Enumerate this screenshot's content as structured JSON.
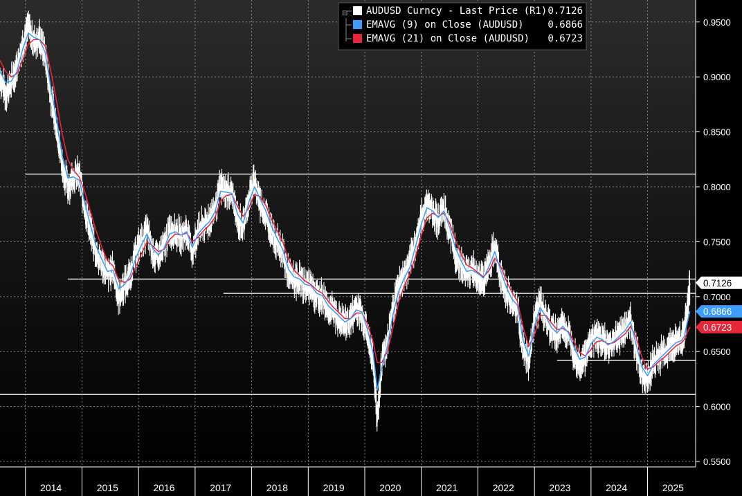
{
  "chart_data": {
    "type": "line",
    "title": "",
    "xlabel": "",
    "ylabel": "",
    "x_ticks": [
      "2014",
      "2015",
      "2016",
      "2017",
      "2018",
      "2019",
      "2020",
      "2021",
      "2022",
      "2023",
      "2024",
      "2025"
    ],
    "ylim": [
      0.545,
      0.97
    ],
    "y_ticks": [
      "0.9500",
      "0.9000",
      "0.8500",
      "0.8000",
      "0.7500",
      "0.7000",
      "0.6500",
      "0.6000",
      "0.5500"
    ],
    "grid": true,
    "legend_position": "top-center",
    "background": "#000000",
    "colors": {
      "price": "#ffffff",
      "ema9": "#3d9dff",
      "ema21": "#e8263a",
      "levels": "#ffffff"
    },
    "legend": [
      {
        "label": "AUDUSD Curncy  - Last Price (R1)",
        "value": "0.7126",
        "color": "#ffffff"
      },
      {
        "label": "EMAVG (9)  on Close (AUDUSD)",
        "value": "0.6866",
        "color": "#3d9dff"
      },
      {
        "label": "EMAVG (21)  on Close (AUDUSD)",
        "value": "0.6723",
        "color": "#e8263a"
      }
    ],
    "last_value_tags": [
      {
        "value": "0.7126",
        "y": 0.7126,
        "bg": "#ffffff",
        "fg": "#000000"
      },
      {
        "value": "0.6866",
        "y": 0.6866,
        "bg": "#3d9dff",
        "fg": "#ffffff"
      },
      {
        "value": "0.6723",
        "y": 0.6723,
        "bg": "#e8263a",
        "fg": "#ffffff"
      }
    ],
    "horizontal_levels": [
      {
        "y": 0.8115,
        "from": 2014.0
      },
      {
        "y": 0.716,
        "from": 2014.75
      },
      {
        "y": 0.703,
        "from": 2017.5
      },
      {
        "y": 0.642,
        "from": 2023.4
      },
      {
        "y": 0.611,
        "from": 2013.55
      }
    ],
    "series": [
      {
        "name": "AUDUSD Curncy  - Last Price (R1)",
        "color": "#ffffff",
        "x": [
          2013.55,
          2013.65,
          2013.75,
          2013.85,
          2013.95,
          2014.05,
          2014.15,
          2014.25,
          2014.35,
          2014.45,
          2014.55,
          2014.65,
          2014.75,
          2014.85,
          2014.95,
          2015.05,
          2015.15,
          2015.25,
          2015.35,
          2015.45,
          2015.55,
          2015.65,
          2015.75,
          2015.85,
          2015.95,
          2016.05,
          2016.15,
          2016.25,
          2016.35,
          2016.45,
          2016.55,
          2016.65,
          2016.75,
          2016.85,
          2016.95,
          2017.05,
          2017.15,
          2017.25,
          2017.35,
          2017.45,
          2017.55,
          2017.65,
          2017.75,
          2017.85,
          2017.95,
          2018.05,
          2018.15,
          2018.25,
          2018.35,
          2018.45,
          2018.55,
          2018.65,
          2018.75,
          2018.85,
          2018.95,
          2019.05,
          2019.15,
          2019.25,
          2019.35,
          2019.45,
          2019.55,
          2019.65,
          2019.75,
          2019.85,
          2019.95,
          2020.05,
          2020.15,
          2020.22,
          2020.3,
          2020.4,
          2020.5,
          2020.6,
          2020.7,
          2020.8,
          2020.9,
          2021.0,
          2021.1,
          2021.2,
          2021.3,
          2021.4,
          2021.5,
          2021.6,
          2021.7,
          2021.8,
          2021.9,
          2022.0,
          2022.1,
          2022.2,
          2022.3,
          2022.4,
          2022.5,
          2022.6,
          2022.7,
          2022.8,
          2022.9,
          2023.0,
          2023.1,
          2023.2,
          2023.3,
          2023.4,
          2023.5,
          2023.6,
          2023.7,
          2023.8,
          2023.9,
          2024.0,
          2024.1,
          2024.2,
          2024.3,
          2024.4,
          2024.5,
          2024.6,
          2024.7,
          2024.8,
          2024.9,
          2025.0,
          2025.1,
          2025.2,
          2025.3,
          2025.4,
          2025.5,
          2025.6,
          2025.65,
          2025.7,
          2025.75
        ],
        "values": [
          0.9,
          0.885,
          0.895,
          0.91,
          0.93,
          0.945,
          0.932,
          0.935,
          0.92,
          0.88,
          0.855,
          0.82,
          0.8,
          0.81,
          0.81,
          0.78,
          0.76,
          0.74,
          0.73,
          0.72,
          0.725,
          0.7,
          0.71,
          0.72,
          0.74,
          0.75,
          0.76,
          0.74,
          0.735,
          0.745,
          0.76,
          0.76,
          0.755,
          0.76,
          0.74,
          0.76,
          0.765,
          0.77,
          0.78,
          0.8,
          0.795,
          0.795,
          0.77,
          0.765,
          0.79,
          0.805,
          0.785,
          0.775,
          0.76,
          0.75,
          0.74,
          0.72,
          0.715,
          0.715,
          0.71,
          0.71,
          0.7,
          0.7,
          0.69,
          0.685,
          0.68,
          0.675,
          0.68,
          0.69,
          0.685,
          0.665,
          0.64,
          0.59,
          0.64,
          0.66,
          0.69,
          0.71,
          0.72,
          0.73,
          0.75,
          0.77,
          0.785,
          0.778,
          0.77,
          0.78,
          0.76,
          0.74,
          0.73,
          0.72,
          0.725,
          0.72,
          0.715,
          0.73,
          0.745,
          0.72,
          0.705,
          0.695,
          0.69,
          0.65,
          0.64,
          0.68,
          0.695,
          0.68,
          0.67,
          0.665,
          0.675,
          0.665,
          0.65,
          0.64,
          0.645,
          0.66,
          0.665,
          0.66,
          0.655,
          0.66,
          0.665,
          0.67,
          0.68,
          0.65,
          0.63,
          0.625,
          0.64,
          0.645,
          0.65,
          0.655,
          0.66,
          0.66,
          0.665,
          0.69,
          0.712
        ]
      },
      {
        "name": "EMAVG (9)  on Close (AUDUSD)",
        "color": "#3d9dff",
        "x": [
          2013.55,
          2013.65,
          2013.75,
          2013.85,
          2013.95,
          2014.05,
          2014.15,
          2014.25,
          2014.35,
          2014.45,
          2014.55,
          2014.65,
          2014.75,
          2014.85,
          2014.95,
          2015.05,
          2015.15,
          2015.25,
          2015.35,
          2015.45,
          2015.55,
          2015.65,
          2015.75,
          2015.85,
          2015.95,
          2016.05,
          2016.15,
          2016.25,
          2016.35,
          2016.45,
          2016.55,
          2016.65,
          2016.75,
          2016.85,
          2016.95,
          2017.05,
          2017.15,
          2017.25,
          2017.35,
          2017.45,
          2017.55,
          2017.65,
          2017.75,
          2017.85,
          2017.95,
          2018.05,
          2018.15,
          2018.25,
          2018.35,
          2018.45,
          2018.55,
          2018.65,
          2018.75,
          2018.85,
          2018.95,
          2019.05,
          2019.15,
          2019.25,
          2019.35,
          2019.45,
          2019.55,
          2019.65,
          2019.75,
          2019.85,
          2019.95,
          2020.05,
          2020.15,
          2020.22,
          2020.3,
          2020.4,
          2020.5,
          2020.6,
          2020.7,
          2020.8,
          2020.9,
          2021.0,
          2021.1,
          2021.2,
          2021.3,
          2021.4,
          2021.5,
          2021.6,
          2021.7,
          2021.8,
          2021.9,
          2022.0,
          2022.1,
          2022.2,
          2022.3,
          2022.4,
          2022.5,
          2022.6,
          2022.7,
          2022.8,
          2022.9,
          2023.0,
          2023.1,
          2023.2,
          2023.3,
          2023.4,
          2023.5,
          2023.6,
          2023.7,
          2023.8,
          2023.9,
          2024.0,
          2024.1,
          2024.2,
          2024.3,
          2024.4,
          2024.5,
          2024.6,
          2024.7,
          2024.8,
          2024.9,
          2025.0,
          2025.1,
          2025.2,
          2025.3,
          2025.4,
          2025.5,
          2025.6,
          2025.65,
          2025.7,
          2025.75
        ],
        "values": [
          0.905,
          0.895,
          0.896,
          0.905,
          0.925,
          0.94,
          0.936,
          0.934,
          0.922,
          0.89,
          0.862,
          0.828,
          0.808,
          0.809,
          0.806,
          0.785,
          0.765,
          0.746,
          0.734,
          0.723,
          0.724,
          0.707,
          0.711,
          0.719,
          0.735,
          0.747,
          0.757,
          0.744,
          0.738,
          0.744,
          0.757,
          0.759,
          0.756,
          0.759,
          0.745,
          0.757,
          0.763,
          0.768,
          0.777,
          0.796,
          0.795,
          0.794,
          0.775,
          0.767,
          0.786,
          0.8,
          0.789,
          0.778,
          0.764,
          0.753,
          0.743,
          0.725,
          0.718,
          0.716,
          0.711,
          0.71,
          0.703,
          0.701,
          0.692,
          0.687,
          0.682,
          0.677,
          0.68,
          0.688,
          0.686,
          0.67,
          0.648,
          0.615,
          0.635,
          0.655,
          0.684,
          0.705,
          0.717,
          0.727,
          0.746,
          0.766,
          0.781,
          0.778,
          0.772,
          0.778,
          0.763,
          0.745,
          0.733,
          0.723,
          0.724,
          0.721,
          0.717,
          0.728,
          0.741,
          0.724,
          0.709,
          0.698,
          0.692,
          0.66,
          0.646,
          0.673,
          0.69,
          0.682,
          0.672,
          0.667,
          0.673,
          0.667,
          0.654,
          0.643,
          0.645,
          0.657,
          0.663,
          0.661,
          0.656,
          0.659,
          0.664,
          0.669,
          0.677,
          0.656,
          0.636,
          0.628,
          0.638,
          0.643,
          0.648,
          0.653,
          0.658,
          0.66,
          0.664,
          0.676,
          0.6866
        ]
      },
      {
        "name": "EMAVG (21)  on Close (AUDUSD)",
        "color": "#e8263a",
        "x": [
          2013.55,
          2013.65,
          2013.75,
          2013.85,
          2013.95,
          2014.05,
          2014.15,
          2014.25,
          2014.35,
          2014.45,
          2014.55,
          2014.65,
          2014.75,
          2014.85,
          2014.95,
          2015.05,
          2015.15,
          2015.25,
          2015.35,
          2015.45,
          2015.55,
          2015.65,
          2015.75,
          2015.85,
          2015.95,
          2016.05,
          2016.15,
          2016.25,
          2016.35,
          2016.45,
          2016.55,
          2016.65,
          2016.75,
          2016.85,
          2016.95,
          2017.05,
          2017.15,
          2017.25,
          2017.35,
          2017.45,
          2017.55,
          2017.65,
          2017.75,
          2017.85,
          2017.95,
          2018.05,
          2018.15,
          2018.25,
          2018.35,
          2018.45,
          2018.55,
          2018.65,
          2018.75,
          2018.85,
          2018.95,
          2019.05,
          2019.15,
          2019.25,
          2019.35,
          2019.45,
          2019.55,
          2019.65,
          2019.75,
          2019.85,
          2019.95,
          2020.05,
          2020.15,
          2020.22,
          2020.3,
          2020.4,
          2020.5,
          2020.6,
          2020.7,
          2020.8,
          2020.9,
          2021.0,
          2021.1,
          2021.2,
          2021.3,
          2021.4,
          2021.5,
          2021.6,
          2021.7,
          2021.8,
          2021.9,
          2022.0,
          2022.1,
          2022.2,
          2022.3,
          2022.4,
          2022.5,
          2022.6,
          2022.7,
          2022.8,
          2022.9,
          2023.0,
          2023.1,
          2023.2,
          2023.3,
          2023.4,
          2023.5,
          2023.6,
          2023.7,
          2023.8,
          2023.9,
          2024.0,
          2024.1,
          2024.2,
          2024.3,
          2024.4,
          2024.5,
          2024.6,
          2024.7,
          2024.8,
          2024.9,
          2025.0,
          2025.1,
          2025.2,
          2025.3,
          2025.4,
          2025.5,
          2025.6,
          2025.65,
          2025.7,
          2025.75
        ],
        "values": [
          0.915,
          0.905,
          0.9,
          0.903,
          0.915,
          0.93,
          0.934,
          0.934,
          0.928,
          0.905,
          0.878,
          0.848,
          0.825,
          0.815,
          0.809,
          0.795,
          0.777,
          0.76,
          0.745,
          0.733,
          0.728,
          0.715,
          0.713,
          0.716,
          0.727,
          0.739,
          0.75,
          0.746,
          0.741,
          0.743,
          0.752,
          0.757,
          0.756,
          0.758,
          0.75,
          0.754,
          0.76,
          0.765,
          0.772,
          0.787,
          0.792,
          0.793,
          0.782,
          0.773,
          0.781,
          0.793,
          0.791,
          0.783,
          0.771,
          0.76,
          0.75,
          0.734,
          0.724,
          0.719,
          0.714,
          0.711,
          0.706,
          0.703,
          0.696,
          0.69,
          0.685,
          0.68,
          0.68,
          0.685,
          0.685,
          0.675,
          0.658,
          0.64,
          0.64,
          0.65,
          0.672,
          0.695,
          0.71,
          0.721,
          0.737,
          0.756,
          0.772,
          0.776,
          0.773,
          0.776,
          0.767,
          0.752,
          0.739,
          0.729,
          0.726,
          0.722,
          0.718,
          0.724,
          0.735,
          0.728,
          0.715,
          0.704,
          0.696,
          0.672,
          0.655,
          0.665,
          0.683,
          0.683,
          0.676,
          0.67,
          0.671,
          0.668,
          0.659,
          0.649,
          0.646,
          0.652,
          0.659,
          0.66,
          0.657,
          0.658,
          0.662,
          0.666,
          0.673,
          0.663,
          0.645,
          0.634,
          0.636,
          0.641,
          0.645,
          0.65,
          0.655,
          0.658,
          0.661,
          0.667,
          0.6723
        ]
      }
    ]
  }
}
